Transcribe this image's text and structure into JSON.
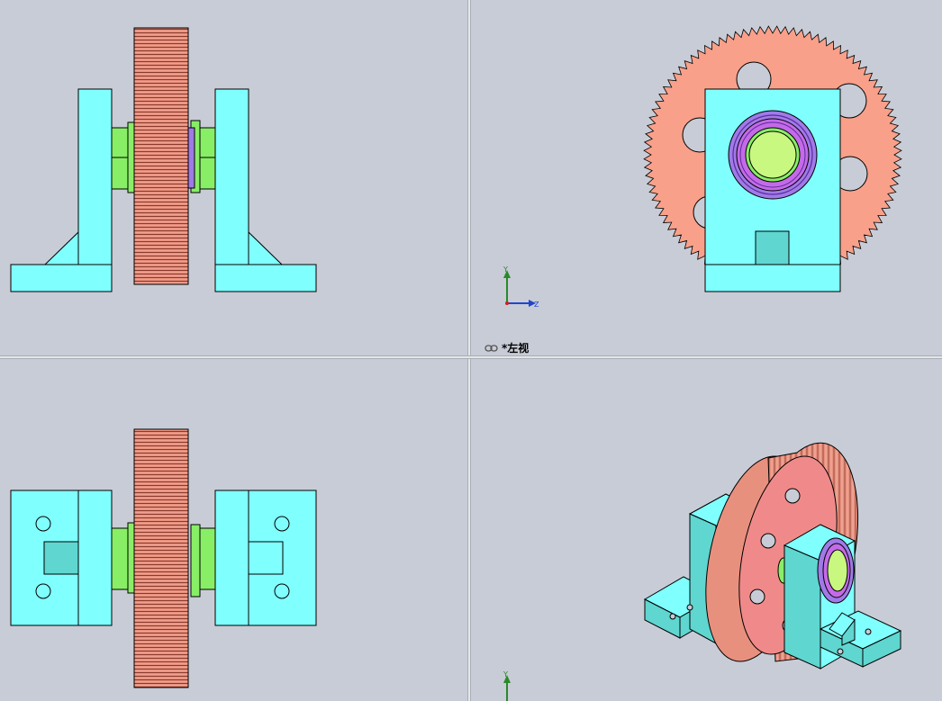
{
  "window": {
    "title": ""
  },
  "viewports": {
    "top_left": {
      "view": "front"
    },
    "top_right": {
      "view": "left",
      "label": "*左视"
    },
    "bottom_left": {
      "view": "top"
    },
    "bottom_right": {
      "view": "isometric"
    }
  },
  "triad": {
    "axis_y": "Y",
    "axis_z": "Z"
  },
  "colors": {
    "background": "#c8ccd6",
    "bracket": "#80ffff",
    "bracket_dark": "#5fd6d0",
    "gear": "#e8907e",
    "gear_face": "#f9a08a",
    "shaft": "#88ee66",
    "bearing": "#a07ae8",
    "bearing_ring": "#c46ae8",
    "shaft_face": "#c8f880"
  },
  "icons": [
    "link-icon",
    "triad-icon"
  ]
}
